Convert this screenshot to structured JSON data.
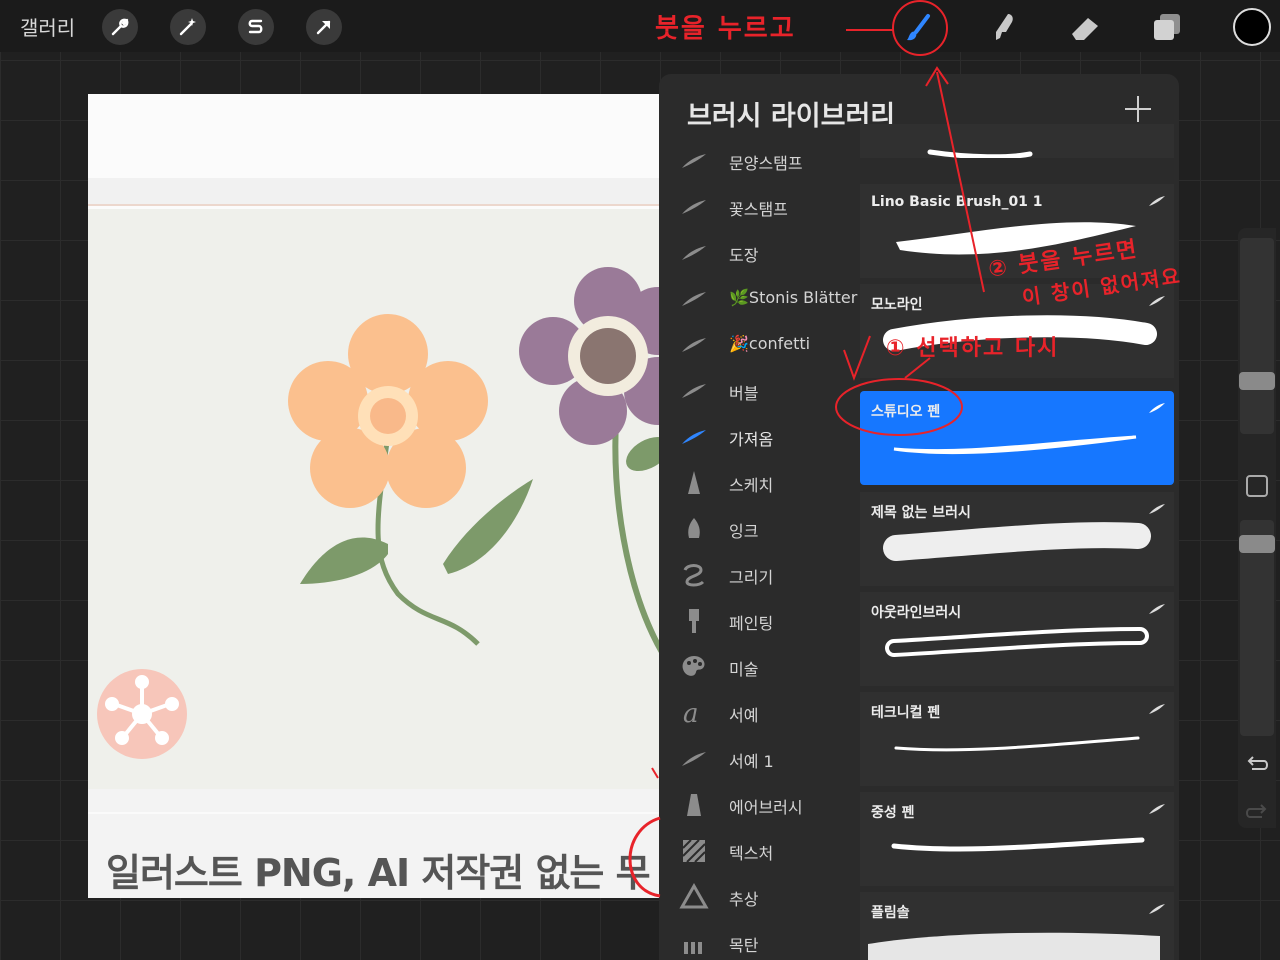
{
  "toolbar": {
    "gallery": "갤러리",
    "tools": [
      "wrench-icon",
      "magic-wand-icon",
      "selection-icon",
      "move-arrow-icon"
    ],
    "right_tools": [
      "brush-icon",
      "smudge-icon",
      "eraser-icon",
      "layers-icon"
    ],
    "color": "#000000"
  },
  "canvas": {
    "caption": "일러스트 PNG, AI 저작권 없는 무"
  },
  "panel": {
    "title": "브러시 라이브러리",
    "sets": [
      {
        "label": "문양스탬프",
        "icon": "brush-stroke-icon"
      },
      {
        "label": "꽃스탬프",
        "icon": "brush-stroke-icon"
      },
      {
        "label": "도장",
        "icon": "brush-stroke-icon"
      },
      {
        "label": "🌿Stonis Blätter",
        "icon": "brush-stroke-icon"
      },
      {
        "label": "🎉confetti",
        "icon": "brush-stroke-icon"
      },
      {
        "label": "버블",
        "icon": "brush-stroke-icon"
      },
      {
        "label": "가져옴",
        "icon": "brush-stroke-icon",
        "active": true
      },
      {
        "label": "스케치",
        "icon": "pencil-tip-icon"
      },
      {
        "label": "잉크",
        "icon": "ink-nib-icon"
      },
      {
        "label": "그리기",
        "icon": "squiggle-icon"
      },
      {
        "label": "페인팅",
        "icon": "paint-brush-icon"
      },
      {
        "label": "미술",
        "icon": "palette-icon"
      },
      {
        "label": "서예",
        "icon": "calligraphy-a-icon"
      },
      {
        "label": "서예 1",
        "icon": "brush-stroke-icon"
      },
      {
        "label": "에어브러시",
        "icon": "airbrush-icon"
      },
      {
        "label": "텍스처",
        "icon": "texture-icon"
      },
      {
        "label": "추상",
        "icon": "triangle-icon"
      },
      {
        "label": "목탄",
        "icon": "charcoal-icon"
      }
    ],
    "brushes": [
      {
        "name": ""
      },
      {
        "name": "Lino Basic Brush_01 1"
      },
      {
        "name": "모노라인"
      },
      {
        "name": "스튜디오 펜",
        "selected": true
      },
      {
        "name": "제목 없는 브러시"
      },
      {
        "name": "아웃라인브러시"
      },
      {
        "name": "테크니컬 펜"
      },
      {
        "name": "중성 펜"
      },
      {
        "name": "플림솔"
      }
    ]
  },
  "annotations": {
    "step_top": "붓을 누르고",
    "step1": "① 선택하고  다시",
    "step2_line1": "② 붓을 누르면",
    "step2_line2": "이 창이 없어져요",
    "accent": "#e8232a"
  }
}
